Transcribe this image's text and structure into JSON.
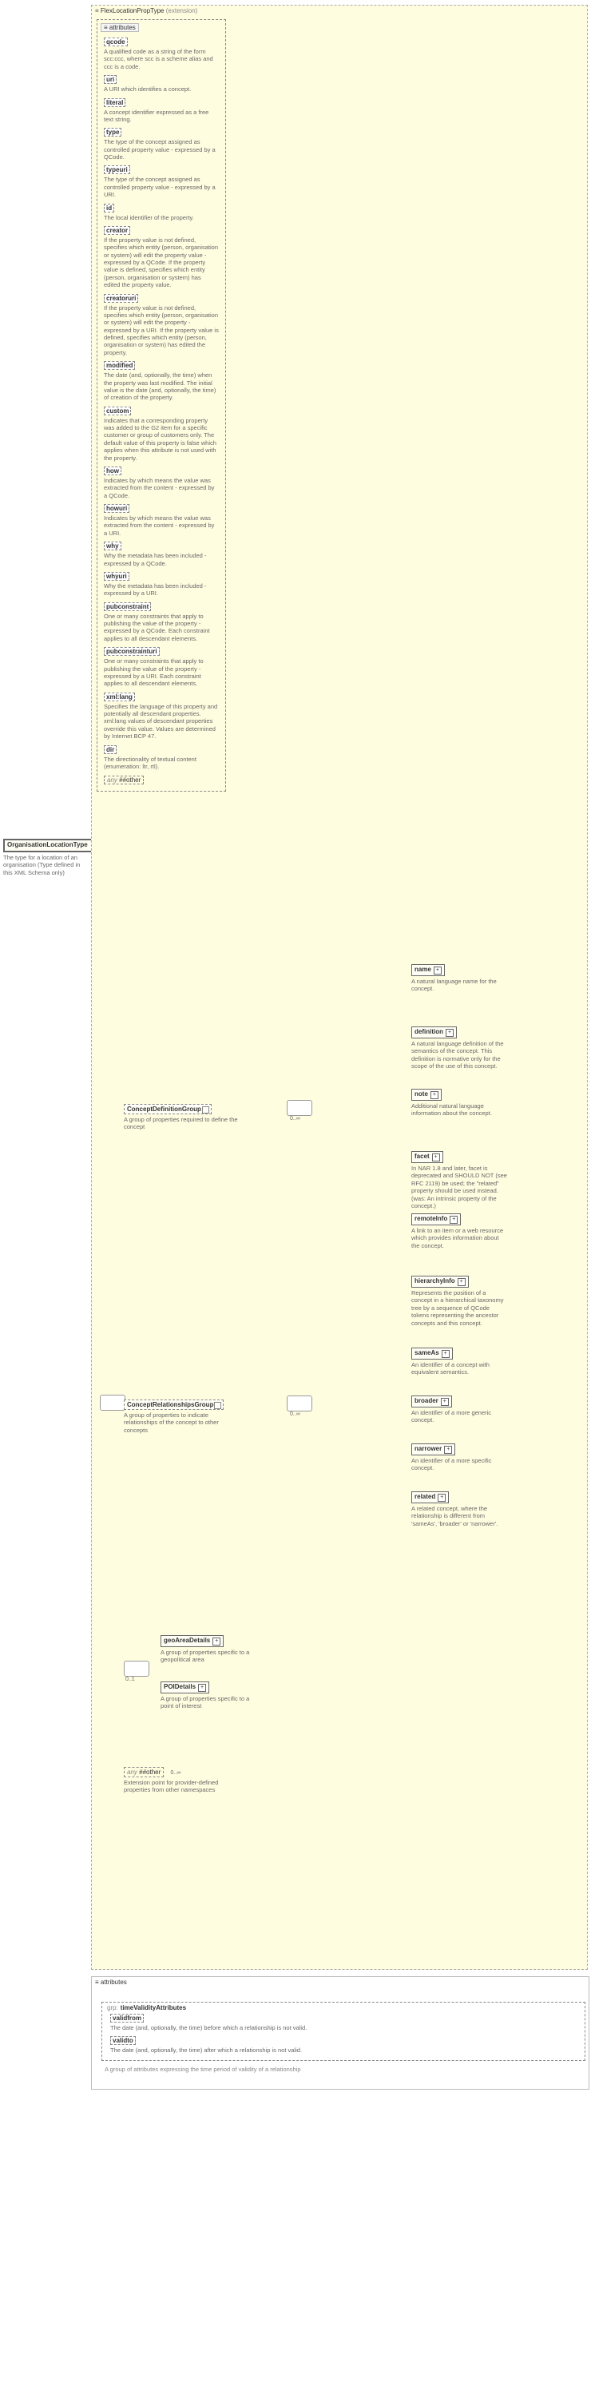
{
  "root": {
    "name": "OrganisationLocationType",
    "desc": "The type for a location of an organisation (Type defined in this XML Schema only)"
  },
  "extension": {
    "header": "FlexLocationPropType",
    "suffix": "(extension)",
    "attributesLabel": "attributes",
    "attributes": [
      {
        "name": "qcode",
        "desc": "A qualified code as a string of the form scc:ccc, where scc is a scheme alias and ccc is a code."
      },
      {
        "name": "uri",
        "desc": "A URI which identifies a concept."
      },
      {
        "name": "literal",
        "desc": "A concept identifier expressed as a free text string."
      },
      {
        "name": "type",
        "desc": "The type of the concept assigned as controlled property value - expressed by a QCode."
      },
      {
        "name": "typeuri",
        "desc": "The type of the concept assigned as controlled property value - expressed by a URI."
      },
      {
        "name": "id",
        "desc": "The local identifier of the property."
      },
      {
        "name": "creator",
        "desc": "If the property value is not defined, specifies which entity (person, organisation or system) will edit the property value - expressed by a QCode. If the property value is defined, specifies which entity (person, organisation or system) has edited the property value."
      },
      {
        "name": "creatoruri",
        "desc": "If the property value is not defined, specifies which entity (person, organisation or system) will edit the property - expressed by a URI. If the property value is defined, specifies which entity (person, organisation or system) has edited the property."
      },
      {
        "name": "modified",
        "desc": "The date (and, optionally, the time) when the property was last modified. The initial value is the date (and, optionally, the time) of creation of the property."
      },
      {
        "name": "custom",
        "desc": "Indicates that a corresponding property was added to the G2 item for a specific customer or group of customers only. The default value of this property is false which applies when this attribute is not used with the property."
      },
      {
        "name": "how",
        "desc": "Indicates by which means the value was extracted from the content - expressed by a QCode."
      },
      {
        "name": "howuri",
        "desc": "Indicates by which means the value was extracted from the content - expressed by a URI."
      },
      {
        "name": "why",
        "desc": "Why the metadata has been included - expressed by a QCode."
      },
      {
        "name": "whyuri",
        "desc": "Why the metadata has been included - expressed by a URI."
      },
      {
        "name": "pubconstraint",
        "desc": "One or many constraints that apply to publishing the value of the property - expressed by a QCode. Each constraint applies to all descendant elements."
      },
      {
        "name": "pubconstrainturi",
        "desc": "One or many constraints that apply to publishing the value of the property - expressed by a URI. Each constraint applies to all descendant elements."
      },
      {
        "name": "xml:lang",
        "desc": "Specifies the language of this property and potentially all descendant properties. xml:lang values of descendant properties override this value. Values are determined by Internet BCP 47."
      },
      {
        "name": "dir",
        "desc": "The directionality of textual content (enumeration: ltr, rtl)."
      }
    ],
    "anyOther": "any ##other"
  },
  "groups": {
    "conceptDef": {
      "name": "ConceptDefinitionGroup",
      "desc": "A group of properties required to define the concept",
      "card": "0..∞",
      "children": [
        {
          "name": "name",
          "desc": "A natural language name for the concept."
        },
        {
          "name": "definition",
          "desc": "A natural language definition of the semantics of the concept. This definition is normative only for the scope of the use of this concept."
        },
        {
          "name": "note",
          "desc": "Additional natural language information about the concept."
        },
        {
          "name": "facet",
          "desc": "In NAR 1.8 and later, facet is deprecated and SHOULD NOT (see RFC 2119) be used; the \"related\" property should be used instead. (was: An intrinsic property of the concept.)"
        },
        {
          "name": "remoteInfo",
          "desc": "A link to an item or a web resource which provides information about the concept."
        },
        {
          "name": "hierarchyInfo",
          "desc": "Represents the position of a concept in a hierarchical taxonomy tree by a sequence of QCode tokens representing the ancestor concepts and this concept."
        }
      ]
    },
    "conceptRel": {
      "name": "ConceptRelationshipsGroup",
      "desc": "A group of properties to indicate relationships of the concept to other concepts",
      "card": "0..∞",
      "children": [
        {
          "name": "sameAs",
          "desc": "An identifier of a concept with equivalent semantics."
        },
        {
          "name": "broader",
          "desc": "An identifier of a more generic concept."
        },
        {
          "name": "narrower",
          "desc": "An identifier of a more specific concept."
        },
        {
          "name": "related",
          "desc": "A related concept, where the relationship is different from 'sameAs', 'broader' or 'narrower'."
        }
      ]
    },
    "choice": [
      {
        "name": "geoAreaDetails",
        "desc": "A group of properties specific to a geopolitical area"
      },
      {
        "name": "POIDetails",
        "desc": "A group of properties specific to a point of interest"
      }
    ],
    "extAny": {
      "label": "any ##other",
      "card": "0..∞",
      "desc": "Extension point for provider-defined properties from other namespaces"
    }
  },
  "validity": {
    "sectionLabel": "attributes",
    "groupPrefix": "grp:",
    "groupName": "timeValidityAttributes",
    "attrs": [
      {
        "name": "validfrom",
        "desc": "The date (and, optionally, the time) before which a relationship is not valid."
      },
      {
        "name": "validto",
        "desc": "The date (and, optionally, the time) after which a relationship is not valid."
      }
    ],
    "groupDesc": "A group of attributes expressing the time period of validity of a relationship"
  }
}
